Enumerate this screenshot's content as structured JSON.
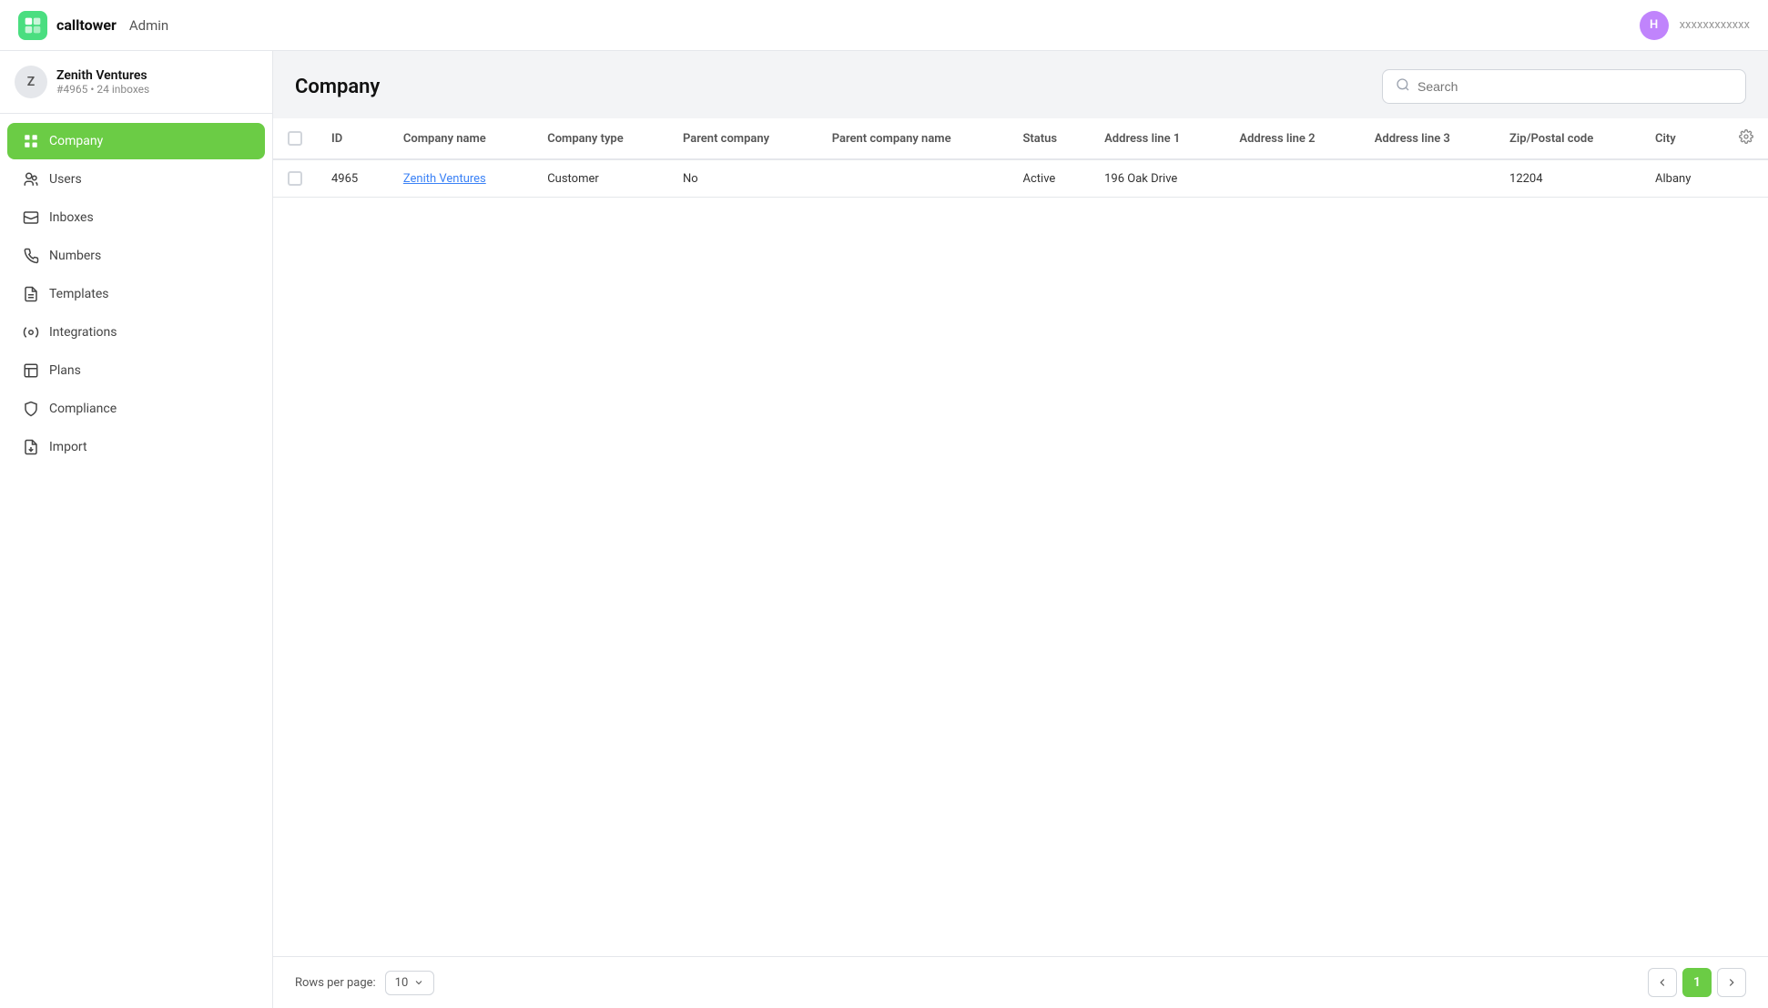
{
  "header": {
    "brand": "calltower",
    "admin_label": "Admin",
    "avatar_letter": "H",
    "user_name": "xxxxxxxxxxxx"
  },
  "sidebar": {
    "account": {
      "name": "Zenith Ventures",
      "sub": "#4965 • 24 inboxes",
      "letter": "Z"
    },
    "nav_items": [
      {
        "id": "company",
        "label": "Company",
        "icon": "company",
        "active": true
      },
      {
        "id": "users",
        "label": "Users",
        "icon": "users",
        "active": false
      },
      {
        "id": "inboxes",
        "label": "Inboxes",
        "icon": "inboxes",
        "active": false
      },
      {
        "id": "numbers",
        "label": "Numbers",
        "icon": "numbers",
        "active": false
      },
      {
        "id": "templates",
        "label": "Templates",
        "icon": "templates",
        "active": false
      },
      {
        "id": "integrations",
        "label": "Integrations",
        "icon": "integrations",
        "active": false
      },
      {
        "id": "plans",
        "label": "Plans",
        "icon": "plans",
        "active": false
      },
      {
        "id": "compliance",
        "label": "Compliance",
        "icon": "compliance",
        "active": false
      },
      {
        "id": "import",
        "label": "Import",
        "icon": "import",
        "active": false
      }
    ]
  },
  "content": {
    "page_title": "Company",
    "search_placeholder": "Search"
  },
  "table": {
    "columns": [
      "ID",
      "Company name",
      "Company type",
      "Parent company",
      "Parent company name",
      "Status",
      "Address line 1",
      "Address line 2",
      "Address line 3",
      "Zip/Postal code",
      "City"
    ],
    "rows": [
      {
        "id": "4965",
        "company_name": "Zenith Ventures",
        "company_type": "Customer",
        "parent_company": "No",
        "parent_company_name": "",
        "status": "Active",
        "address_line_1": "196 Oak Drive",
        "address_line_2": "",
        "address_line_3": "",
        "zip": "12204",
        "city": "Albany"
      }
    ]
  },
  "pagination": {
    "rows_per_page_label": "Rows per page:",
    "rows_per_page_value": "10",
    "current_page": "1",
    "prev_label": "‹",
    "next_label": "›"
  }
}
